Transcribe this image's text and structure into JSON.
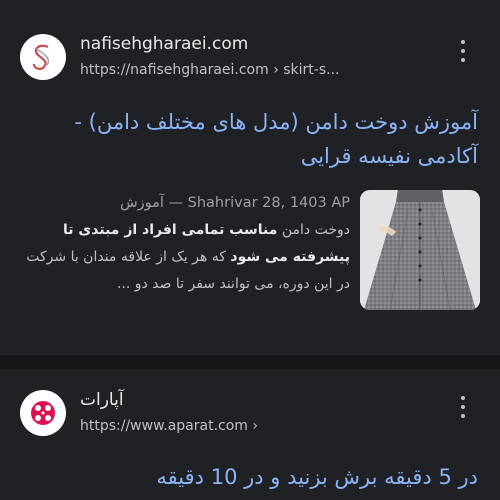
{
  "results": [
    {
      "site_name": "nafisehgharaei.com",
      "url": "https://nafisehgharaei.com › skirt-s...",
      "title": "آموزش دوخت دامن (مدل های مختلف دامن) - آکادمی نفیسه قرایی",
      "meta": "آموزش — Shahrivar 28, 1403 AP",
      "snippet_parts": [
        {
          "text": "دوخت دامن ",
          "bold": false
        },
        {
          "text": "مناسب تمامی افراد از مبتدی تا پیشرفته می شود",
          "bold": true
        },
        {
          "text": " که هر یک از علاقه مندان با شرکت در این دوره، می توانند سفر تا صد دو ...",
          "bold": false
        }
      ],
      "favicon": "nafiseh-logo-icon",
      "thumbnail": "gray-skirt-image"
    },
    {
      "site_name": "آپارات",
      "url": "https://www.aparat.com ›",
      "title": "در 5 دقیقه برش بزنید و در 10 دقیقه",
      "favicon": "aparat-logo-icon"
    }
  ],
  "colors": {
    "background": "#202124",
    "title_link": "#8ab4f8",
    "separator": "#171717",
    "aparat_brand": "#df0f50"
  }
}
